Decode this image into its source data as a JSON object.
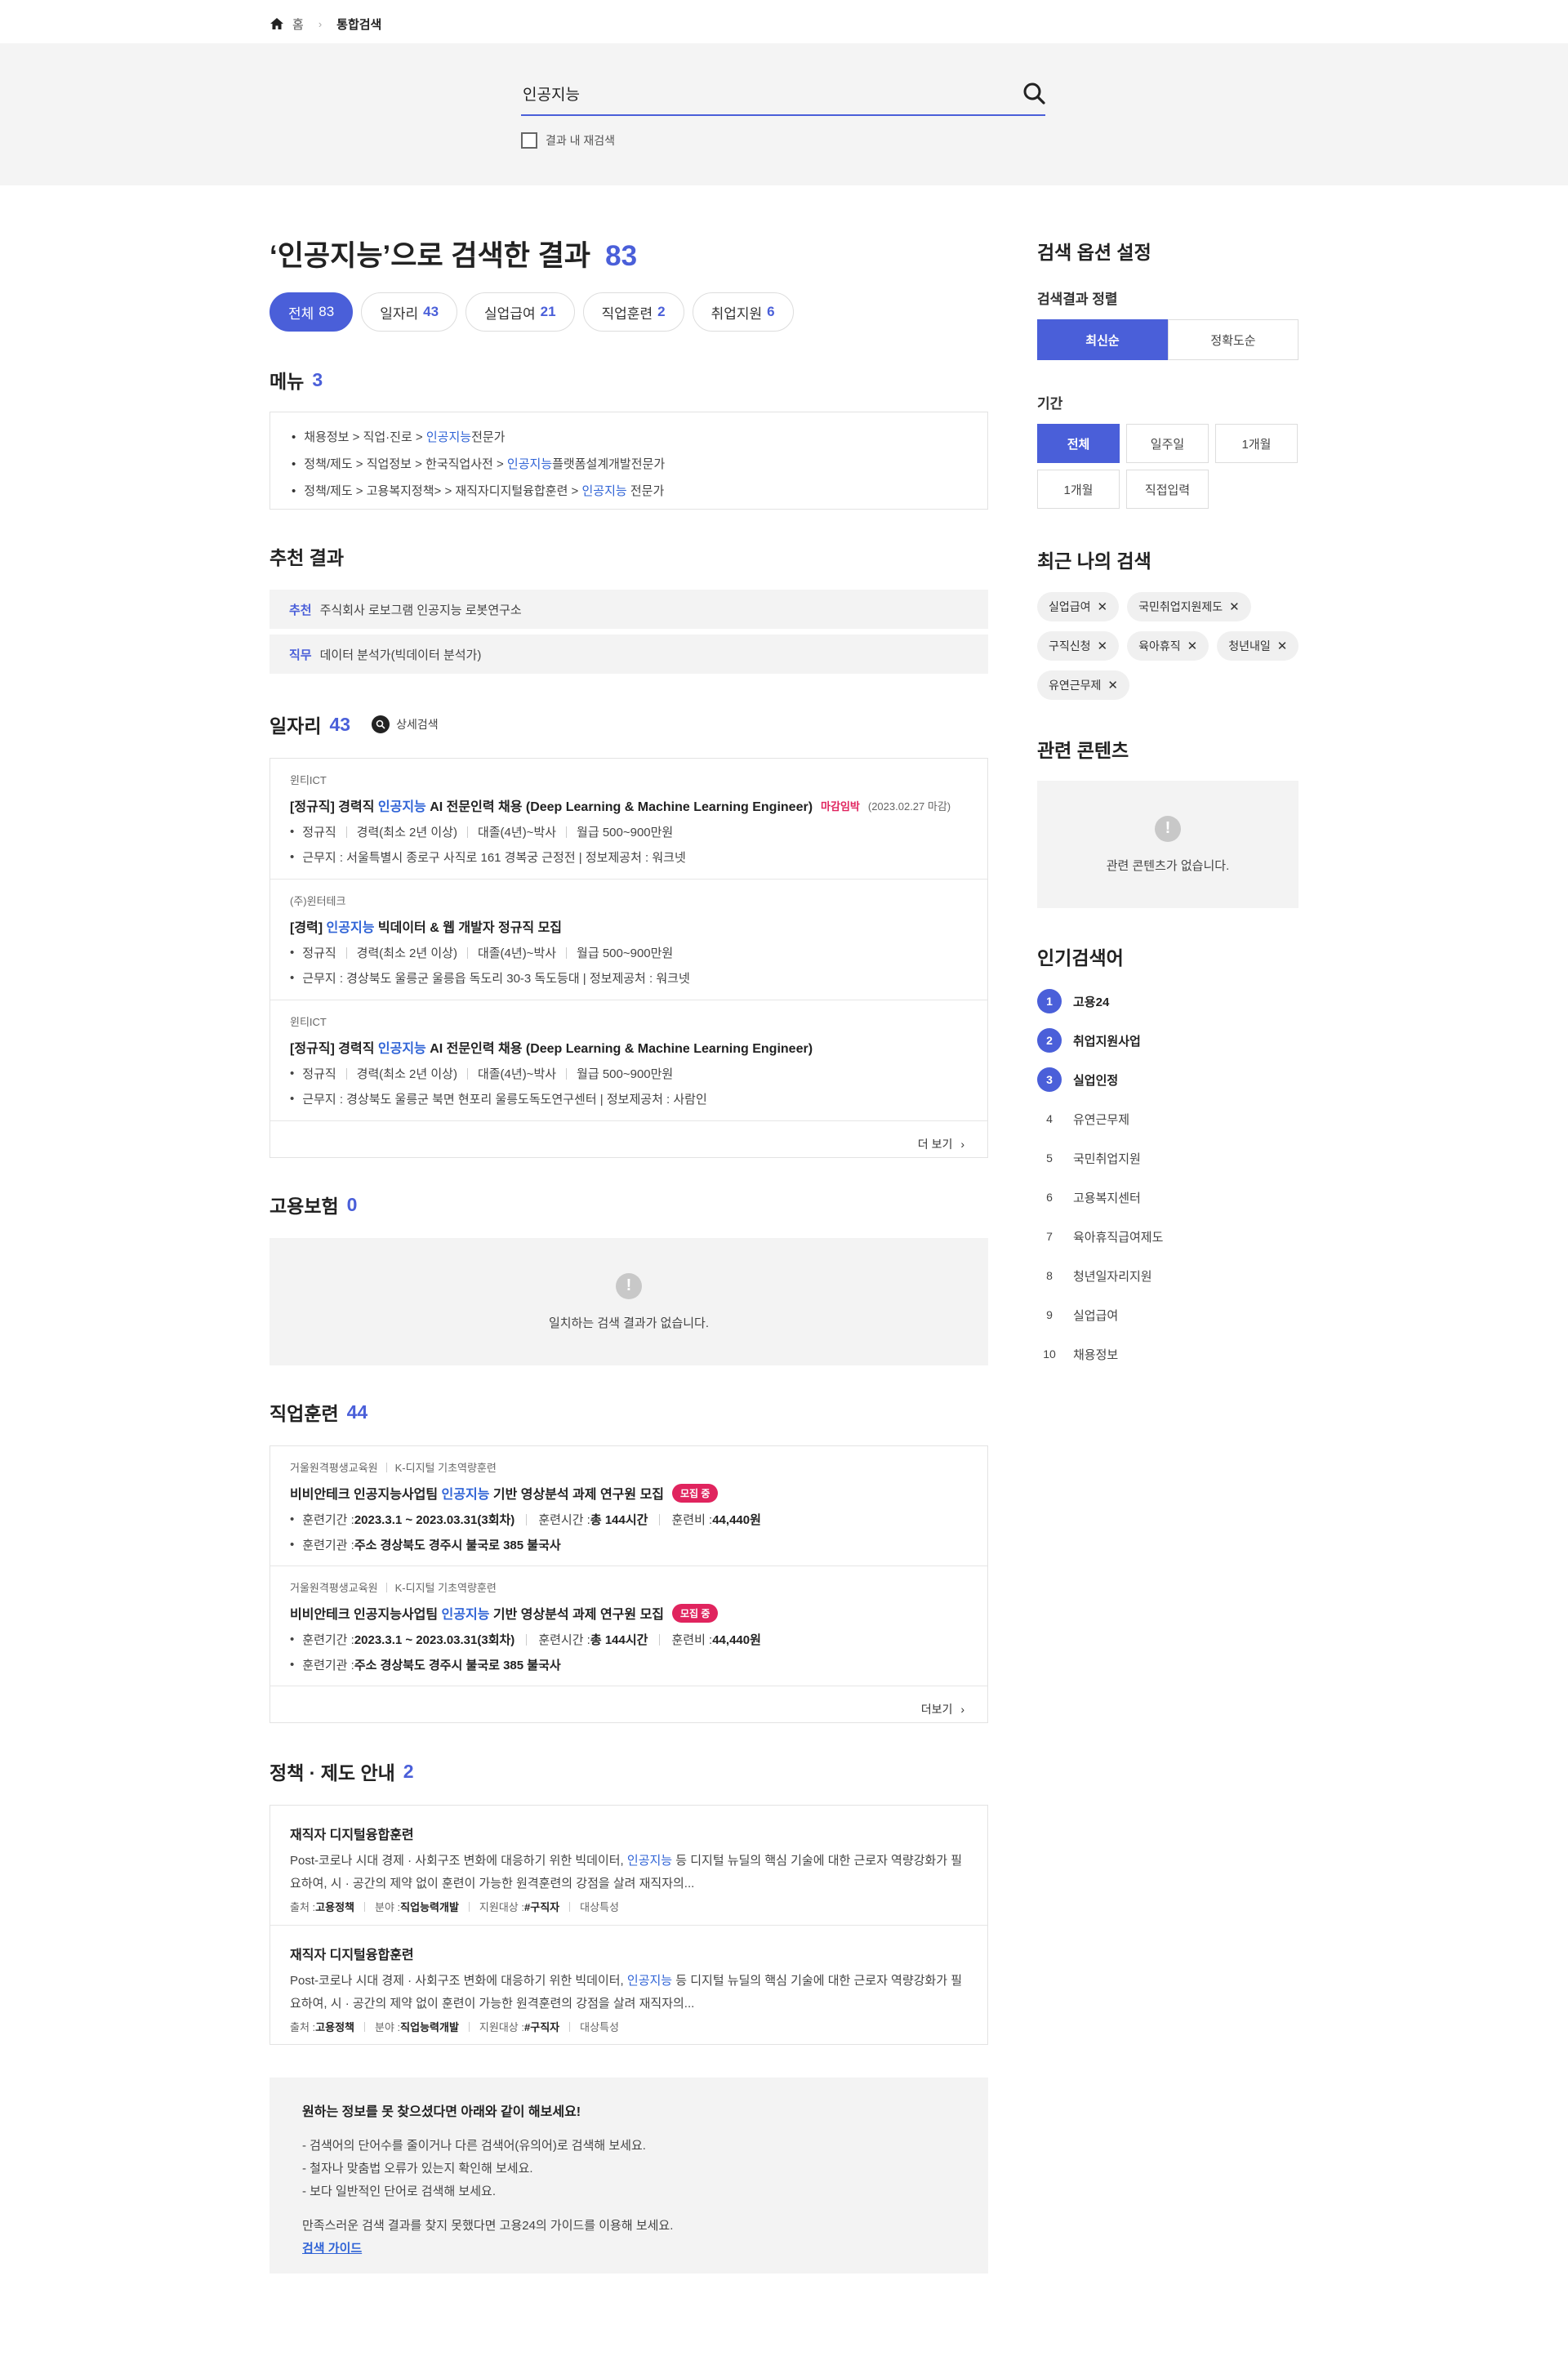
{
  "breadcrumb": {
    "home": "홈",
    "current": "통합검색"
  },
  "search": {
    "query": "인공지능",
    "rescan_label": "결과 내 재검색"
  },
  "result": {
    "title": "‘인공지능’으로 검색한 결과",
    "count": "83"
  },
  "tabs": [
    {
      "label": "전체",
      "count": "83"
    },
    {
      "label": "일자리",
      "count": "43"
    },
    {
      "label": "실업급여",
      "count": "21"
    },
    {
      "label": "직업훈련",
      "count": "2"
    },
    {
      "label": "취업지원",
      "count": "6"
    }
  ],
  "menu": {
    "title": "메뉴",
    "count": "3",
    "items": [
      {
        "pre": "채용정보 > 직업·진로 > ",
        "hl": "인공지능",
        "post": "전문가"
      },
      {
        "pre": "정책/제도 > 직업정보 > 한국직업사전 > ",
        "hl": "인공지능",
        "post": "플랫폼설계개발전문가"
      },
      {
        "pre": "정책/제도 > 고용복지정책> > 재직자디지털융합훈련 > ",
        "hl": "인공지능",
        "post": " 전문가"
      }
    ]
  },
  "recommend": {
    "title": "추천 결과",
    "items": [
      {
        "tag": "추천",
        "text": "주식회사 로보그램 인공지능 로봇연구소"
      },
      {
        "tag": "직무",
        "text": "데이터 분석가(빅데이터 분석가)"
      }
    ]
  },
  "jobs": {
    "title": "일자리",
    "count": "43",
    "detail_label": "상세검색",
    "more_label": "더 보기",
    "items": [
      {
        "company": "윈티ICT",
        "pre": "[정규직] 경력직 ",
        "hl": "인공지능",
        "post": " AI 전문인력 채용 (Deep Learning & Machine Learning Engineer)",
        "due": "마감임박",
        "date": "(2023.02.27 마감)",
        "type": "정규직",
        "career": "경력(최소 2년 이상)",
        "edu": "대졸(4년)~박사",
        "pay": "월급 500~900만원",
        "place": "근무지 : 서울특별시 종로구 사직로 161 경복궁 근정전  |  정보제공처 : 워크넷"
      },
      {
        "company": "(주)윈터테크",
        "pre": "[경력] ",
        "hl": "인공지능",
        "post": " 빅데이터 & 웹 개발자 정규직 모집",
        "due": "",
        "date": "",
        "type": "정규직",
        "career": "경력(최소 2년 이상)",
        "edu": "대졸(4년)~박사",
        "pay": "월급 500~900만원",
        "place": "근무지 : 경상북도 울릉군 울릉읍 독도리 30-3 독도등대  |  정보제공처 : 워크넷"
      },
      {
        "company": "윈티ICT",
        "pre": "[정규직] 경력직 ",
        "hl": "인공지능",
        "post": " AI 전문인력 채용 (Deep Learning & Machine Learning Engineer)",
        "due": "",
        "date": "",
        "type": "정규직",
        "career": "경력(최소 2년 이상)",
        "edu": "대졸(4년)~박사",
        "pay": "월급 500~900만원",
        "place": "근무지 : 경상북도 울릉군 북면 현포리 울릉도독도연구센터  |  정보제공처 : 사람인"
      }
    ]
  },
  "insurance": {
    "title": "고용보험",
    "count": "0",
    "empty": "일치하는 검색 결과가 없습니다."
  },
  "training": {
    "title": "직업훈련",
    "count": "44",
    "more_label": "더보기",
    "items": [
      {
        "org": "거울원격평생교육원",
        "kind": "K-디지털 기초역량훈련",
        "pre": "비비안테크 인공지능사업팀 ",
        "hl": "인공지능",
        "post": " 기반 영상분석 과제 연구원 모집",
        "badge": "모집 중",
        "period_label": "훈련기간 : ",
        "period": "2023.3.1 ~ 2023.03.31(3회차)",
        "hours_label": "훈련시간 : ",
        "hours": "총 144시간",
        "fee_label": "훈련비 : ",
        "fee": "44,440원",
        "place_label": "훈련기관 : ",
        "place": "주소 경상북도 경주시 불국로 385 불국사"
      },
      {
        "org": "거울원격평생교육원",
        "kind": "K-디지털 기초역량훈련",
        "pre": "비비안테크 인공지능사업팀 ",
        "hl": "인공지능",
        "post": " 기반 영상분석 과제 연구원 모집",
        "badge": "모집 중",
        "period_label": "훈련기간 : ",
        "period": "2023.3.1 ~ 2023.03.31(3회차)",
        "hours_label": "훈련시간 : ",
        "hours": "총 144시간",
        "fee_label": "훈련비 : ",
        "fee": "44,440원",
        "place_label": "훈련기관 : ",
        "place": "주소 경상북도 경주시 불국로 385 불국사"
      }
    ]
  },
  "policy": {
    "title": "정책 · 제도 안내",
    "count": "2",
    "items": [
      {
        "title": "재직자 디지털융합훈련",
        "pre": "Post-코로나 시대 경제 · 사회구조 변화에 대응하기 위한 빅데이터, ",
        "hl": "인공지능",
        "post": " 등 디지털 뉴딜의 핵심 기술에 대한 근로자 역량강화가 필요하여, 시 · 공간의 제약 없이 훈련이 가능한 원격훈련의 강점을 살려 재직자의...",
        "src_label": "출처 : ",
        "src": "고용정책",
        "field_label": "분야 : ",
        "field": "직업능력개발",
        "target_label": "지원대상 : ",
        "target": "#구직자",
        "extra": "대상특성"
      },
      {
        "title": "재직자 디지털융합훈련",
        "pre": "Post-코로나 시대 경제 · 사회구조 변화에 대응하기 위한 빅데이터, ",
        "hl": "인공지능",
        "post": " 등 디지털 뉴딜의 핵심 기술에 대한 근로자 역량강화가 필요하여, 시 · 공간의 제약 없이 훈련이 가능한 원격훈련의 강점을 살려 재직자의...",
        "src_label": "출처 : ",
        "src": "고용정책",
        "field_label": "분야 : ",
        "field": "직업능력개발",
        "target_label": "지원대상 : ",
        "target": "#구직자",
        "extra": "대상특성"
      }
    ]
  },
  "guide": {
    "heading": "원하는 정보를 못 찾으셨다면 아래와 같이 해보세요!",
    "tips": [
      "- 검색어의 단어수를 줄이거나 다른 검색어(유의어)로 검색해 보세요.",
      "- 철자나 맞춤법 오류가 있는지 확인해 보세요.",
      "- 보다 일반적인 단어로 검색해 보세요."
    ],
    "note": "만족스러운 검색 결과를 찾지 못했다면 고용24의 가이드를 이용해 보세요.",
    "link": "검색 가이드"
  },
  "sidebar": {
    "options_title": "검색 옵션 설정",
    "sort_label": "검색결과 정렬",
    "sort": [
      "최신순",
      "정확도순"
    ],
    "period_label": "기간",
    "periods": [
      "전체",
      "일주일",
      "1개월",
      "1개월",
      "직접입력"
    ],
    "recent_title": "최근 나의 검색",
    "recent": [
      "실업급여",
      "국민취업지원제도",
      "구직신청",
      "육아휴직",
      "청년내일",
      "유연근무제"
    ],
    "related_title": "관련 콘텐츠",
    "related_empty": "관련 콘텐츠가 없습니다.",
    "popular_title": "인기검색어",
    "popular": [
      "고용24",
      "취업지원사업",
      "실업인정",
      "유연근무제",
      "국민취업지원",
      "고용복지센터",
      "육아휴직급여제도",
      "청년일자리지원",
      "실업급여",
      "채용정보"
    ]
  },
  "colors": {
    "accent": "#4a5fd9",
    "badge": "#e0245e",
    "highlight": "#2f63d6"
  }
}
